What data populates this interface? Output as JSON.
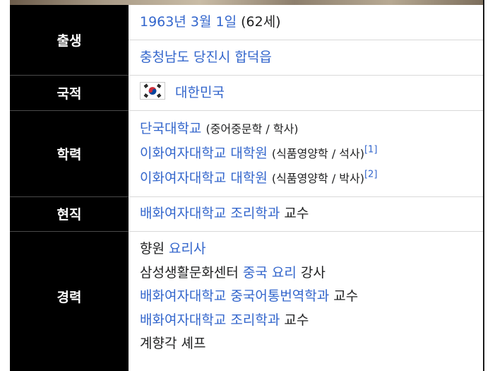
{
  "birth": {
    "header": "출생",
    "date_link": "1963년 3월 1일",
    "age": "(62세)",
    "place_link": "충청남도 당진시 합덕읍"
  },
  "nationality": {
    "header": "국적",
    "country_link": "대한민국",
    "flag_icon": "south-korea-flag-icon"
  },
  "education": {
    "header": "학력",
    "items": [
      {
        "school": "단국대학교",
        "detail": "(중어중문학 / 학사)",
        "ref": ""
      },
      {
        "school": "이화여자대학교 대학원",
        "detail": "(식품영양학 / 석사)",
        "ref": "[1]"
      },
      {
        "school": "이화여자대학교 대학원",
        "detail": "(식품영양학 / 박사)",
        "ref": "[2]"
      }
    ]
  },
  "current_position": {
    "header": "현직",
    "org_link": "배화여자대학교 조리학과",
    "role": "교수"
  },
  "career": {
    "header": "경력",
    "lines": [
      {
        "pre": "향원 ",
        "link": "요리사",
        "post": ""
      },
      {
        "pre": "삼성생활문화센터 ",
        "link": "중국 요리",
        "post": " 강사"
      },
      {
        "pre": "",
        "link": "배화여자대학교 중국어통번역학과",
        "post": " 교수"
      },
      {
        "pre": "",
        "link": "배화여자대학교 조리학과",
        "post": " 교수"
      },
      {
        "pre": "계향각 셰프",
        "link": "",
        "post": ""
      }
    ]
  },
  "colors": {
    "header_bg": "#000000",
    "header_text": "#ffffff",
    "link": "#3366cc",
    "text": "#202122"
  }
}
